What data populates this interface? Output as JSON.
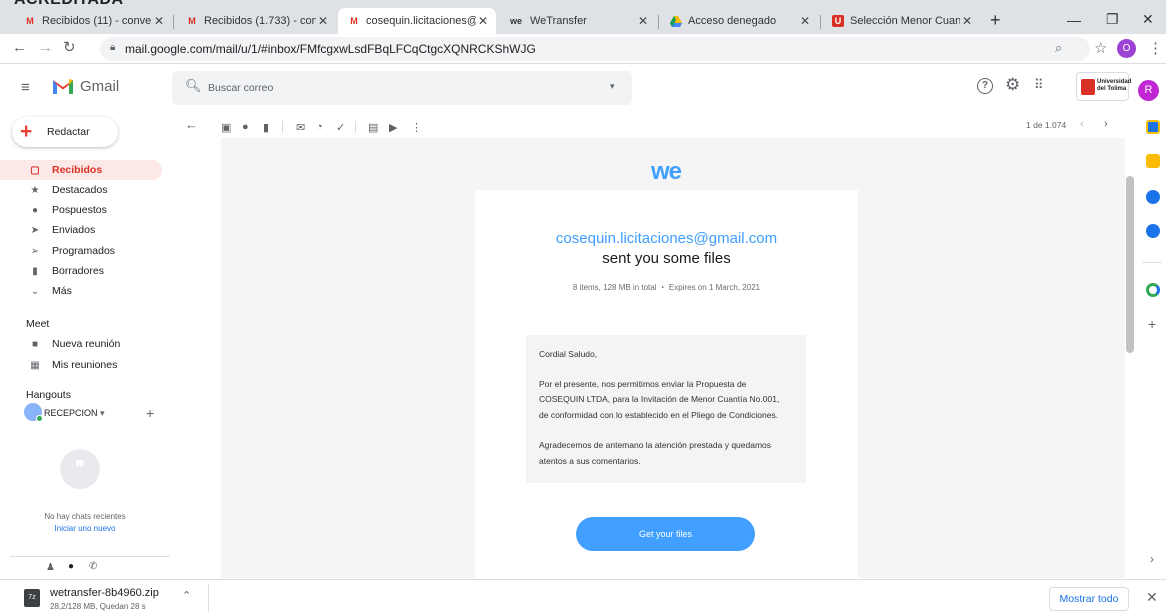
{
  "heading_fragment": "ACREDITADA",
  "browser": {
    "tabs": [
      {
        "label": "Recibidos (11) - conven",
        "icon": "gmail-icon"
      },
      {
        "label": "Recibidos (1.733) - cont",
        "icon": "gmail-icon"
      },
      {
        "label": "cosequin.licitaciones@",
        "icon": "gmail-icon"
      },
      {
        "label": "WeTransfer",
        "icon": "wetransfer-icon"
      },
      {
        "label": "Acceso denegado",
        "icon": "drive-icon"
      },
      {
        "label": "Selección Menor Cuant",
        "icon": "university-icon"
      }
    ],
    "url": "mail.google.com/mail/u/1/#inbox/FMfcgxwLsdFBqLFCqCtgcXQNRCKShWJG",
    "profile_initial": "O"
  },
  "gmail": {
    "app_name": "Gmail",
    "search_placeholder": "Buscar correo",
    "org_logo_text": "Universidad del Tolima",
    "account_initial": "R",
    "compose_label": "Redactar",
    "nav": [
      {
        "label": "Recibidos",
        "icon": "inbox-icon"
      },
      {
        "label": "Destacados",
        "icon": "star-icon"
      },
      {
        "label": "Pospuestos",
        "icon": "clock-icon"
      },
      {
        "label": "Enviados",
        "icon": "send-icon"
      },
      {
        "label": "Programados",
        "icon": "scheduled-icon"
      },
      {
        "label": "Borradores",
        "icon": "draft-icon"
      },
      {
        "label": "Más",
        "icon": "chevron-down-icon"
      }
    ],
    "meet_title": "Meet",
    "meet_items": [
      "Nueva reunión",
      "Mis reuniones"
    ],
    "hangouts_title": "Hangouts",
    "hangouts_user": "RECEPCION",
    "no_chats": "No hay chats recientes",
    "start_new": "Iniciar uno nuevo",
    "pagination": "1 de 1.074"
  },
  "email": {
    "brand_logo": "we",
    "sender": "cosequin.licitaciones@gmail.com",
    "headline": "sent you some files",
    "meta": "8 items, 128 MB in total  ・  Expires on 1 March, 2021",
    "message_lines": [
      "Cordial Saludo,",
      "Por el presente, nos permitimos enviar la Propuesta de",
      "COSEQUIN LTDA, para la Invitación de Menor Cuantía No.001,",
      "de conformidad con lo establecido en el Pliego de Condiciones.",
      "Agradecemos de antemano la atención prestada y quedamos",
      "atentos a sus comentarios."
    ],
    "cta": "Get your files"
  },
  "download": {
    "filename": "wetransfer-8b4960.zip",
    "status": "28,2/128 MB, Quedan 28 s",
    "show_all": "Mostrar todo"
  },
  "colors": {
    "accent_red": "#d93025",
    "wetransfer_blue": "#409fff",
    "link_blue": "#1a73e8"
  }
}
